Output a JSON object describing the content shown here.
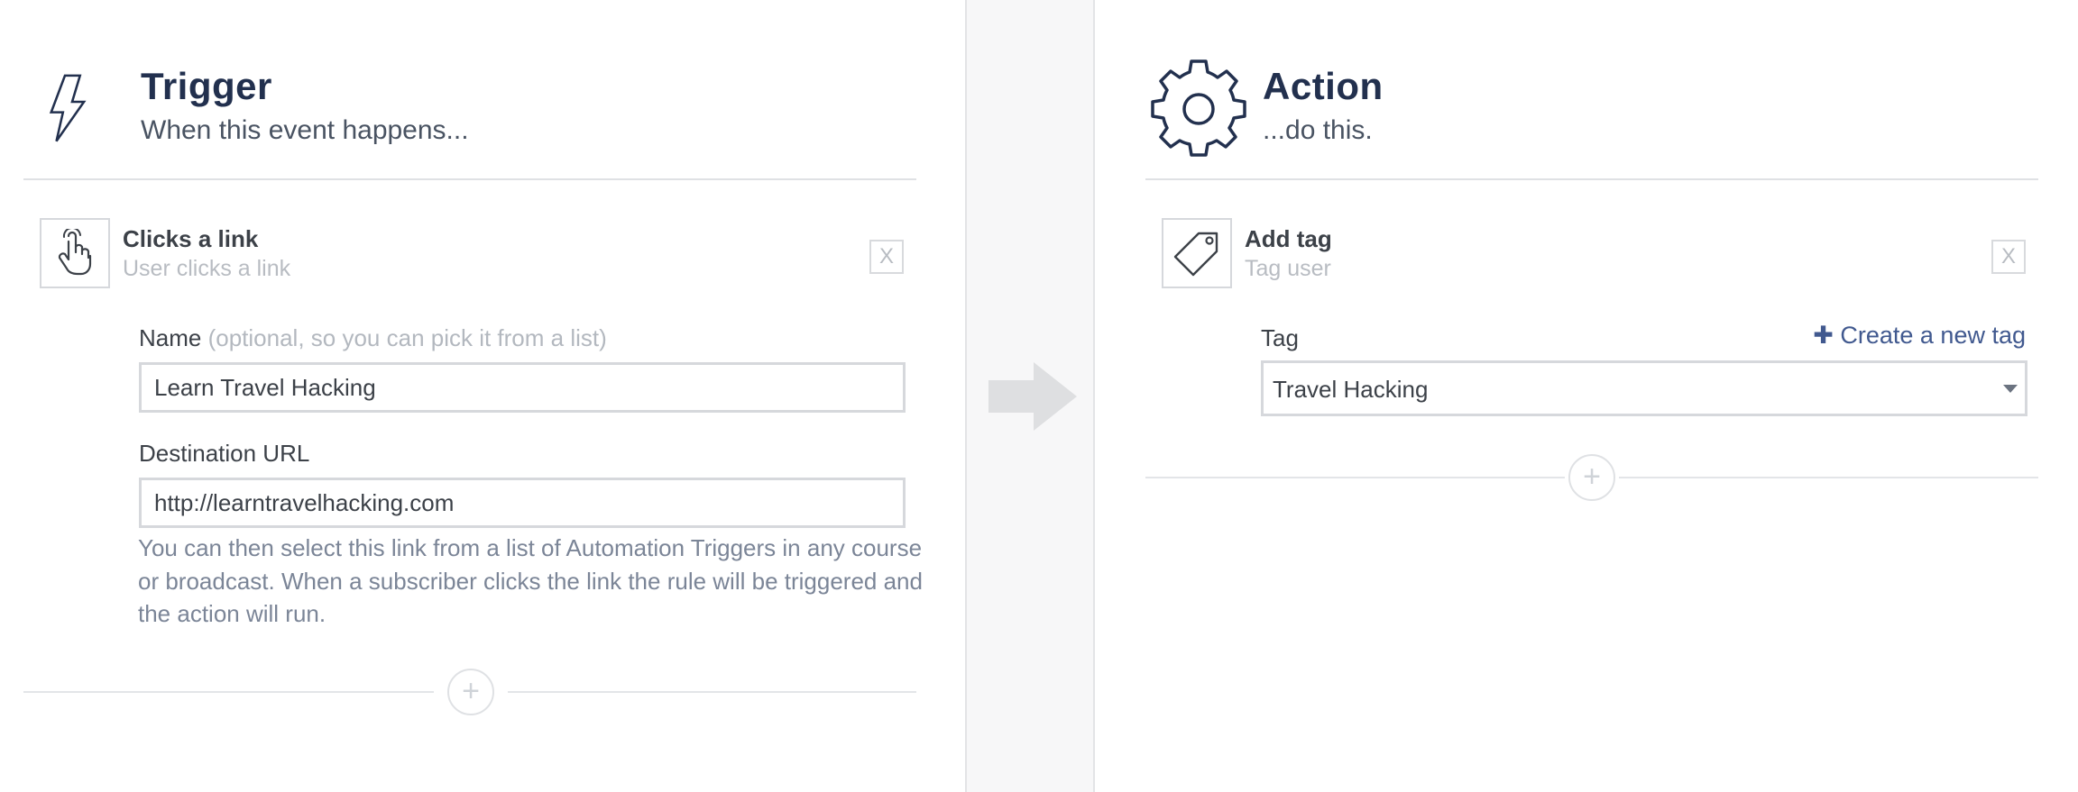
{
  "trigger": {
    "title": "Trigger",
    "subtitle": "When this event happens...",
    "item": {
      "title": "Clicks a link",
      "description": "User clicks a link",
      "close_label": "X"
    },
    "name_field": {
      "label": "Name",
      "hint": "(optional, so you can pick it from a list)",
      "value": "Learn Travel Hacking"
    },
    "url_field": {
      "label": "Destination URL",
      "value": "http://learntravelhacking.com"
    },
    "help_text": "You can then select this link from a list of Automation Triggers in any course or broadcast. When a subscriber clicks the link the rule will be triggered and the action will run.",
    "add_symbol": "+"
  },
  "action": {
    "title": "Action",
    "subtitle": "...do this.",
    "item": {
      "title": "Add tag",
      "description": "Tag user",
      "close_label": "X"
    },
    "tag_field": {
      "label": "Tag",
      "selected": "Travel Hacking"
    },
    "create_tag_label": "Create a new tag",
    "create_tag_symbol": "✚",
    "add_symbol": "+"
  },
  "icons": {
    "trigger": "lightning-bolt-icon",
    "action": "gear-icon",
    "trigger_item": "pointer-hand-icon",
    "action_item": "price-tag-icon",
    "flow": "right-arrow-icon"
  },
  "colors": {
    "heading": "#22304e",
    "link": "#41598f",
    "help_text": "#7b8597",
    "muted": "#b8bcc2",
    "divider_bg": "#f7f7f8"
  }
}
